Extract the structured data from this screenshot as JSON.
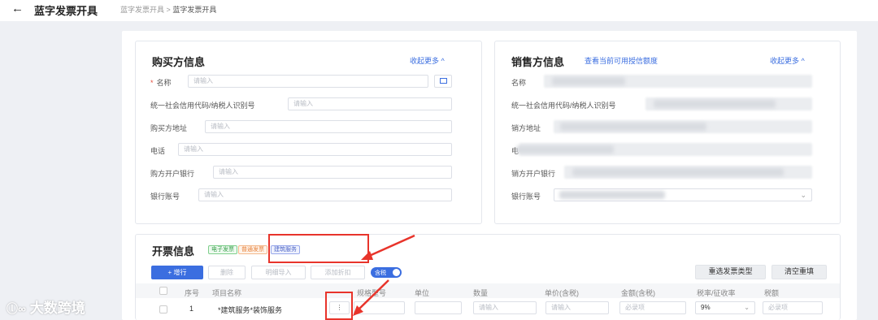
{
  "header": {
    "back_icon": "←",
    "title": "蓝字发票开具",
    "breadcrumb_parent": "蓝字发票开具",
    "breadcrumb_sep": ">",
    "breadcrumb_current": "蓝字发票开具"
  },
  "buyer": {
    "title": "购买方信息",
    "collapse_label": "收起更多 ^",
    "fields": [
      {
        "label": "名称",
        "required": "*",
        "placeholder": "请输入"
      },
      {
        "label": "统一社会信用代码/纳税人识别号",
        "placeholder": "请输入"
      },
      {
        "label": "购买方地址",
        "placeholder": "请输入"
      },
      {
        "label": "电话",
        "placeholder": "请输入"
      },
      {
        "label": "购方开户银行",
        "placeholder": "请输入"
      },
      {
        "label": "银行账号",
        "placeholder": "请输入"
      }
    ]
  },
  "seller": {
    "title": "销售方信息",
    "credit_link": "查看当前可用授信额度",
    "collapse_label": "收起更多 ^",
    "fields": [
      {
        "label": "名称"
      },
      {
        "label": "统一社会信用代码/纳税人识别号"
      },
      {
        "label": "销方地址"
      },
      {
        "label": "电"
      },
      {
        "label": "销方开户银行"
      },
      {
        "label": "银行账号"
      }
    ]
  },
  "invoice": {
    "title": "开票信息",
    "tags": [
      "电子发票",
      "普通发票",
      "建筑服务"
    ],
    "buttons": {
      "add_row": "+ 增行",
      "delete": "删除",
      "batch_import": "明细导入",
      "add_discount": "添加折扣",
      "tax_toggle": "含税",
      "reselect_type": "重选发票类型",
      "clear": "清空重填"
    },
    "columns": [
      "序号",
      "项目名称",
      "规格型号",
      "单位",
      "数量",
      "单价(含税)",
      "金额(含税)",
      "税率/征收率",
      "税额"
    ],
    "row": {
      "index": "1",
      "item_name": "*建筑服务*装饰服务",
      "more": "⋮",
      "qty_placeholder": "请输入",
      "price_placeholder": "请输入",
      "amount_placeholder": "必录项",
      "tax_rate": "9%",
      "tax_placeholder": "必录项"
    }
  },
  "watermark": "大数跨境",
  "colors": {
    "accent": "#3b6ee0",
    "annotation_red": "#e8342b"
  }
}
